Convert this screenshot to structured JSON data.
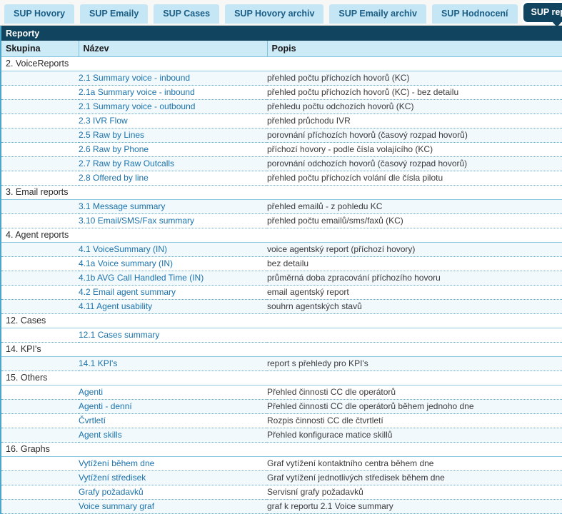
{
  "tabs": [
    {
      "label": "SUP Hovory",
      "active": false
    },
    {
      "label": "SUP Emaily",
      "active": false
    },
    {
      "label": "SUP Cases",
      "active": false
    },
    {
      "label": "SUP Hovory archiv",
      "active": false
    },
    {
      "label": "SUP Emaily archiv",
      "active": false
    },
    {
      "label": "SUP Hodnocení",
      "active": false
    },
    {
      "label": "SUP reporty",
      "active": true
    }
  ],
  "page": {
    "title": "Reporty"
  },
  "table": {
    "columns": [
      "Skupina",
      "Název",
      "Popis"
    ],
    "rows": [
      {
        "type": "group",
        "skupina": "2. VoiceReports",
        "nazev": "",
        "popis": ""
      },
      {
        "type": "item",
        "skupina": "",
        "nazev": "2.1 Summary voice - inbound",
        "popis": "přehled počtu příchozích hovorů (KC)"
      },
      {
        "type": "item",
        "skupina": "",
        "nazev": "2.1a Summary voice - inbound",
        "popis": "přehled počtu příchozích hovorů (KC) - bez detailu"
      },
      {
        "type": "item",
        "skupina": "",
        "nazev": "2.1 Summary voice - outbound",
        "popis": "přehledu počtu odchozích hovorů (KC)"
      },
      {
        "type": "item",
        "skupina": "",
        "nazev": "2.3 IVR Flow",
        "popis": "přehled průchodu IVR"
      },
      {
        "type": "item",
        "skupina": "",
        "nazev": "2.5 Raw by Lines",
        "popis": "porovnání příchozích hovorů (časový rozpad hovorů)"
      },
      {
        "type": "item",
        "skupina": "",
        "nazev": "2.6 Raw by Phone",
        "popis": "příchozí hovory - podle čísla volajícího (KC)"
      },
      {
        "type": "item",
        "skupina": "",
        "nazev": "2.7 Raw by Raw Outcalls",
        "popis": "porovnání odchozích hovorů (časový rozpad hovorů)"
      },
      {
        "type": "item",
        "skupina": "",
        "nazev": "2.8 Offered by line",
        "popis": "přehled počtu příchozích volání dle čísla pilotu"
      },
      {
        "type": "group",
        "skupina": "3. Email reports",
        "nazev": "",
        "popis": ""
      },
      {
        "type": "item",
        "skupina": "",
        "nazev": "3.1 Message summary",
        "popis": "přehled emailů - z pohledu KC"
      },
      {
        "type": "item",
        "skupina": "",
        "nazev": "3.10 Email/SMS/Fax summary",
        "popis": "přehled počtu emailů/sms/faxů (KC)"
      },
      {
        "type": "group",
        "skupina": "4. Agent reports",
        "nazev": "",
        "popis": ""
      },
      {
        "type": "item",
        "skupina": "",
        "nazev": "4.1 VoiceSummary (IN)",
        "popis": "voice agentský report (příchozí hovory)"
      },
      {
        "type": "item",
        "skupina": "",
        "nazev": "4.1a Voice summary (IN)",
        "popis": "bez detailu"
      },
      {
        "type": "item",
        "skupina": "",
        "nazev": "4.1b AVG Call Handled Time (IN)",
        "popis": "průměrná doba zpracování příchozího hovoru"
      },
      {
        "type": "item",
        "skupina": "",
        "nazev": "4.2 Email agent summary",
        "popis": "email agentský report"
      },
      {
        "type": "item",
        "skupina": "",
        "nazev": "4.11 Agent usability",
        "popis": "souhrn agentských stavů"
      },
      {
        "type": "group",
        "skupina": "12. Cases",
        "nazev": "",
        "popis": ""
      },
      {
        "type": "item",
        "skupina": "",
        "nazev": "12.1 Cases summary",
        "popis": ""
      },
      {
        "type": "group",
        "skupina": "14. KPI's",
        "nazev": "",
        "popis": ""
      },
      {
        "type": "item",
        "skupina": "",
        "nazev": "14.1 KPI's",
        "popis": "report s přehledy pro KPI's"
      },
      {
        "type": "group",
        "skupina": "15. Others",
        "nazev": "",
        "popis": ""
      },
      {
        "type": "item",
        "skupina": "",
        "nazev": "Agenti",
        "popis": "Přehled činnosti CC dle operátorů"
      },
      {
        "type": "item",
        "skupina": "",
        "nazev": "Agenti - denní",
        "popis": "Přehled činnosti CC dle operátorů během jednoho dne"
      },
      {
        "type": "item",
        "skupina": "",
        "nazev": "Čvrtletí",
        "popis": "Rozpis činnosti CC dle čtvrtletí"
      },
      {
        "type": "item",
        "skupina": "",
        "nazev": "Agent skills",
        "popis": "Přehled konfigurace matice skillů"
      },
      {
        "type": "group",
        "skupina": "16. Graphs",
        "nazev": "",
        "popis": ""
      },
      {
        "type": "item",
        "skupina": "",
        "nazev": "Vytížení během dne",
        "popis": "Graf vytížení kontaktního centra během dne"
      },
      {
        "type": "item",
        "skupina": "",
        "nazev": "Vytížení středisek",
        "popis": "Graf vytížení jednotlivých středisek během dne"
      },
      {
        "type": "item",
        "skupina": "",
        "nazev": "Grafy požadavků",
        "popis": "Servisní grafy požadavků"
      },
      {
        "type": "item",
        "skupina": "",
        "nazev": "Voice summary graf",
        "popis": "graf k reportu 2.1 Voice summary"
      }
    ]
  },
  "colors": {
    "header_navy": "#10445f",
    "tab_inactive": "#c5e6f5",
    "column_header": "#cdeaf7",
    "link_blue": "#1a72ab",
    "row_stripe": "#f2f9fd",
    "dotted_border": "#5aa9cc",
    "left_rail": "#4da6c8"
  }
}
